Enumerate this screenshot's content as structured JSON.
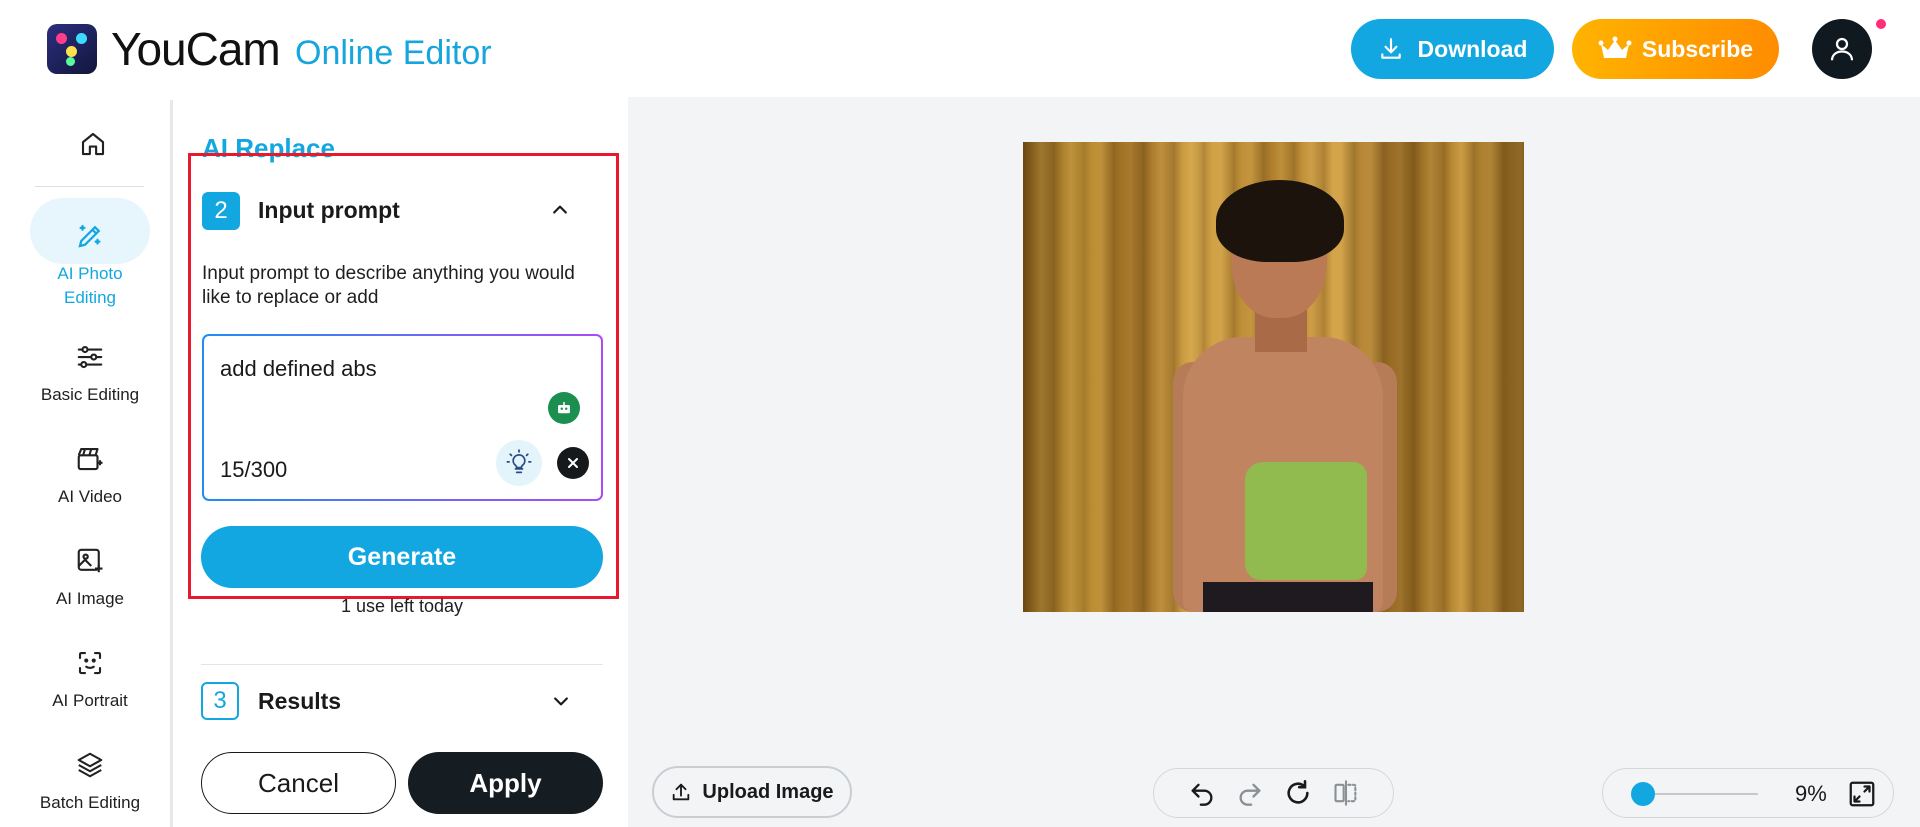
{
  "brand": {
    "name": "YouCam",
    "product": "Online Editor"
  },
  "header": {
    "download_label": "Download",
    "subscribe_label": "Subscribe"
  },
  "rail": {
    "items": [
      {
        "label": "AI Photo Editing",
        "icon": "magic-pencil-icon",
        "active": true
      },
      {
        "label": "Basic Editing",
        "icon": "sliders-icon"
      },
      {
        "label": "AI Video",
        "icon": "clapper-icon"
      },
      {
        "label": "AI Image",
        "icon": "image-sparkle-icon"
      },
      {
        "label": "AI Portrait",
        "icon": "face-scan-icon"
      },
      {
        "label": "Batch Editing",
        "icon": "layers-icon"
      }
    ]
  },
  "panel": {
    "title": "AI Replace",
    "step2": {
      "number": "2",
      "title": "Input prompt"
    },
    "description": "Input prompt to describe anything you would like to replace or add",
    "prompt": {
      "value": "add defined abs",
      "counter": "15/300"
    },
    "generate_label": "Generate",
    "uses_left": "1 use left today",
    "step3": {
      "number": "3",
      "title": "Results"
    },
    "cancel_label": "Cancel",
    "apply_label": "Apply"
  },
  "canvas": {
    "upload_label": "Upload Image",
    "zoom": "9%"
  },
  "colors": {
    "accent": "#12a7e0",
    "subscribe": "#ffa000",
    "highlight_border": "#e8192c",
    "mask": "#8dc04e"
  }
}
